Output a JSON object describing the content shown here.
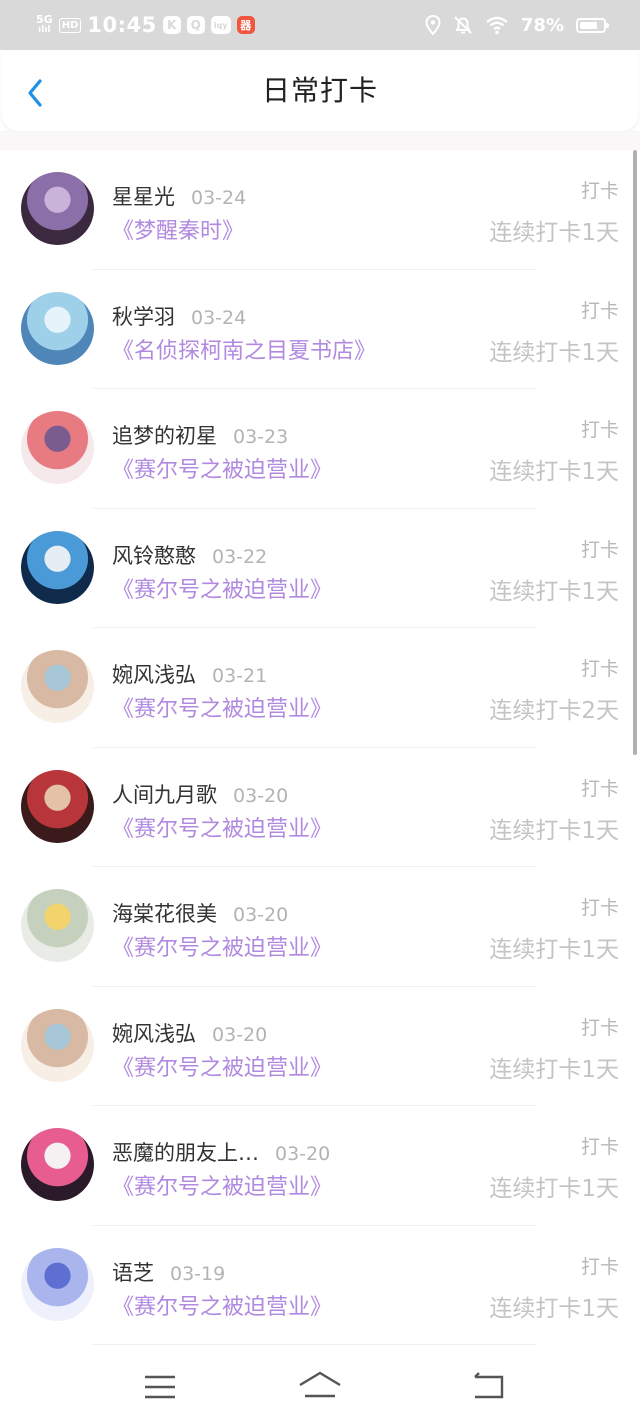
{
  "status_bar": {
    "network_top": "5G",
    "network_bottom": "ılıl",
    "hd": "HD",
    "time": "10:45",
    "app_icons": [
      "K",
      "Q",
      "iqy",
      "器"
    ],
    "battery_text": "78%",
    "battery_level": 0.78
  },
  "header": {
    "title": "日常打卡",
    "accent_color": "#1e8fe6"
  },
  "list": {
    "book_color": "#b18ae0",
    "items": [
      {
        "name": "星星光",
        "date": "03-24",
        "book": "《梦醒秦时》",
        "tag": "打卡",
        "streak": "连续打卡1天"
      },
      {
        "name": "秋学羽",
        "date": "03-24",
        "book": "《名侦探柯南之目夏书店》",
        "tag": "打卡",
        "streak": "连续打卡1天"
      },
      {
        "name": "追梦的初星",
        "date": "03-23",
        "book": "《赛尔号之被迫营业》",
        "tag": "打卡",
        "streak": "连续打卡1天"
      },
      {
        "name": "风铃憨憨",
        "date": "03-22",
        "book": "《赛尔号之被迫营业》",
        "tag": "打卡",
        "streak": "连续打卡1天"
      },
      {
        "name": "婉风浅弘",
        "date": "03-21",
        "book": "《赛尔号之被迫营业》",
        "tag": "打卡",
        "streak": "连续打卡2天"
      },
      {
        "name": "人间九月歌",
        "date": "03-20",
        "book": "《赛尔号之被迫营业》",
        "tag": "打卡",
        "streak": "连续打卡1天"
      },
      {
        "name": "海棠花很美",
        "date": "03-20",
        "book": "《赛尔号之被迫营业》",
        "tag": "打卡",
        "streak": "连续打卡1天"
      },
      {
        "name": "婉风浅弘",
        "date": "03-20",
        "book": "《赛尔号之被迫营业》",
        "tag": "打卡",
        "streak": "连续打卡1天"
      },
      {
        "name": "恶魔的朋友上…",
        "date": "03-20",
        "book": "《赛尔号之被迫营业》",
        "tag": "打卡",
        "streak": "连续打卡1天"
      },
      {
        "name": "语芝",
        "date": "03-19",
        "book": "《赛尔号之被迫营业》",
        "tag": "打卡",
        "streak": "连续打卡1天"
      }
    ]
  },
  "nav_bar": {
    "icons": [
      "menu-icon",
      "home-icon",
      "back-icon"
    ]
  }
}
